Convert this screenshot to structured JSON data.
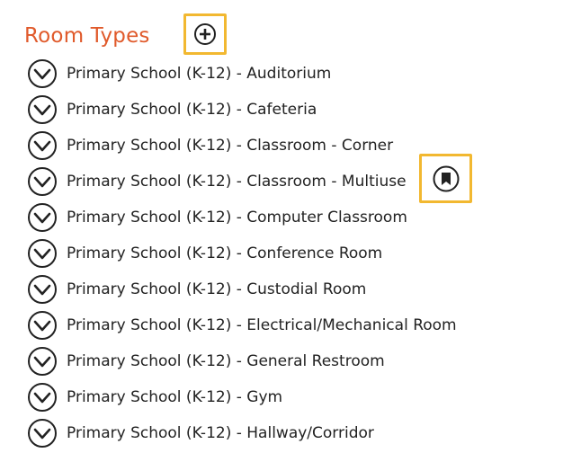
{
  "header": {
    "title": "Room Types"
  },
  "room_types": [
    {
      "label": "Primary School (K-12) - Auditorium"
    },
    {
      "label": "Primary School (K-12) - Cafeteria"
    },
    {
      "label": "Primary School (K-12) - Classroom - Corner"
    },
    {
      "label": "Primary School (K-12) - Classroom - Multiuse"
    },
    {
      "label": "Primary School (K-12) - Computer Classroom"
    },
    {
      "label": "Primary School (K-12) - Conference Room"
    },
    {
      "label": "Primary School (K-12) - Custodial Room"
    },
    {
      "label": "Primary School (K-12) - Electrical/Mechanical Room"
    },
    {
      "label": "Primary School (K-12) - General Restroom"
    },
    {
      "label": "Primary School (K-12) - Gym"
    },
    {
      "label": "Primary School (K-12) - Hallway/Corridor"
    }
  ],
  "icons": {
    "add": "plus-circle-icon",
    "expand": "chevron-down-circle-icon",
    "bookmark": "bookmark-circle-icon"
  },
  "colors": {
    "title": "#e05a2b",
    "highlight": "#f2b830",
    "icon": "#222222"
  }
}
